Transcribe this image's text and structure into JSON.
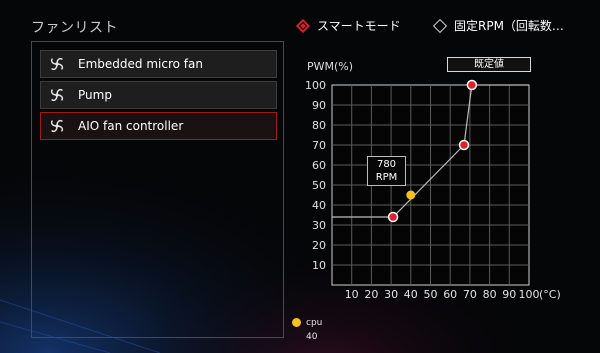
{
  "fan_list": {
    "title": "ファンリスト",
    "items": [
      {
        "label": "Embedded micro fan",
        "selected": false
      },
      {
        "label": "Pump",
        "selected": false
      },
      {
        "label": "AIO fan controller",
        "selected": true
      }
    ]
  },
  "modes": {
    "smart": {
      "label": "スマートモード",
      "active": true
    },
    "fixed": {
      "label": "固定RPM（回転数…",
      "active": false
    }
  },
  "curve": {
    "ylabel": "PWM(%)",
    "default_button": "既定値",
    "unit": "(°C)",
    "tooltip": {
      "line1": "780",
      "line2": "RPM"
    },
    "legend": {
      "name": "cpu",
      "value": "40"
    }
  },
  "chart_data": {
    "type": "line",
    "ylabel": "PWM(%)",
    "xlabel": "(°C)",
    "xlim": [
      0,
      100
    ],
    "ylim": [
      0,
      100
    ],
    "xticks": [
      "10",
      "20",
      "30",
      "40",
      "50",
      "60",
      "70",
      "80",
      "90",
      "100"
    ],
    "yticks": [
      "10",
      "20",
      "30",
      "40",
      "50",
      "60",
      "70",
      "80",
      "90",
      "100"
    ],
    "grid": true,
    "series": [
      {
        "x": [
          0,
          31,
          67,
          71,
          100
        ],
        "y": [
          34,
          34,
          70,
          100,
          100
        ],
        "control_points": [
          [
            31,
            34
          ],
          [
            67,
            70
          ],
          [
            71,
            100
          ]
        ]
      }
    ],
    "current": {
      "x": 40,
      "y": 45,
      "rpm": 780
    },
    "colors": {
      "curve": "#bdbdbd",
      "point": "#e01f2b",
      "current": "#f5c21b",
      "accent": "#d4202a"
    }
  }
}
